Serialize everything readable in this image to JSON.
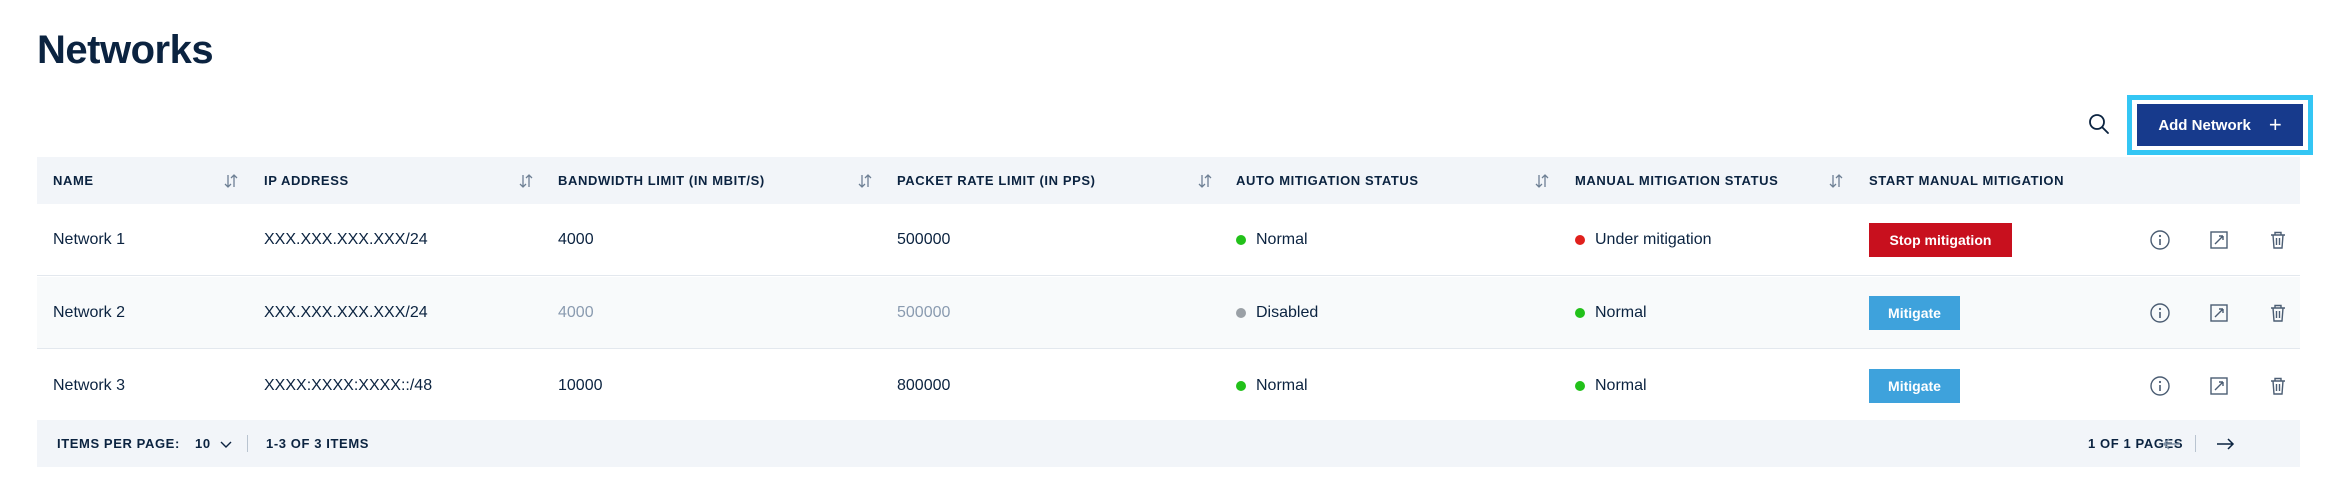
{
  "page": {
    "title": "Networks"
  },
  "toolbar": {
    "add_label": "Add Network",
    "add_plus": "+"
  },
  "table": {
    "columns": [
      "NAME",
      "IP ADDRESS",
      "BANDWIDTH LIMIT (IN MBIT/S)",
      "PACKET RATE LIMIT (IN PPS)",
      "AUTO MITIGATION STATUS",
      "MANUAL MITIGATION STATUS",
      "START MANUAL MITIGATION"
    ],
    "rows": [
      {
        "name": "Network 1",
        "ip": "XXX.XXX.XXX.XXX/24",
        "bandwidth": "4000",
        "packet_rate": "500000",
        "auto_status": "Normal",
        "manual_status": "Under mitigation",
        "action_label": "Stop mitigation"
      },
      {
        "name": "Network 2",
        "ip": "XXX.XXX.XXX.XXX/24",
        "bandwidth": "4000",
        "packet_rate": "500000",
        "auto_status": "Disabled",
        "manual_status": "Normal",
        "action_label": "Mitigate"
      },
      {
        "name": "Network 3",
        "ip": "XXXX:XXXX:XXXX::/48",
        "bandwidth": "10000",
        "packet_rate": "800000",
        "auto_status": "Normal",
        "manual_status": "Normal",
        "action_label": "Mitigate"
      }
    ]
  },
  "footer": {
    "items_per_page_label": "ITEMS PER PAGE:",
    "items_per_page_value": "10",
    "range": "1-3 OF 3 ITEMS",
    "pages": "1 OF 1 PAGES"
  },
  "colors": {
    "status_normal": "#22c11a",
    "status_disabled": "#9aa0a6",
    "status_mitigation": "#e0201c",
    "brand": "#173a8c",
    "focus_ring": "#34c6f4"
  },
  "icons": [
    "search-icon",
    "plus-icon",
    "sort-icon",
    "info-icon",
    "edit-icon",
    "trash-icon",
    "chevron-down-icon",
    "arrow-left-icon",
    "arrow-right-icon"
  ]
}
